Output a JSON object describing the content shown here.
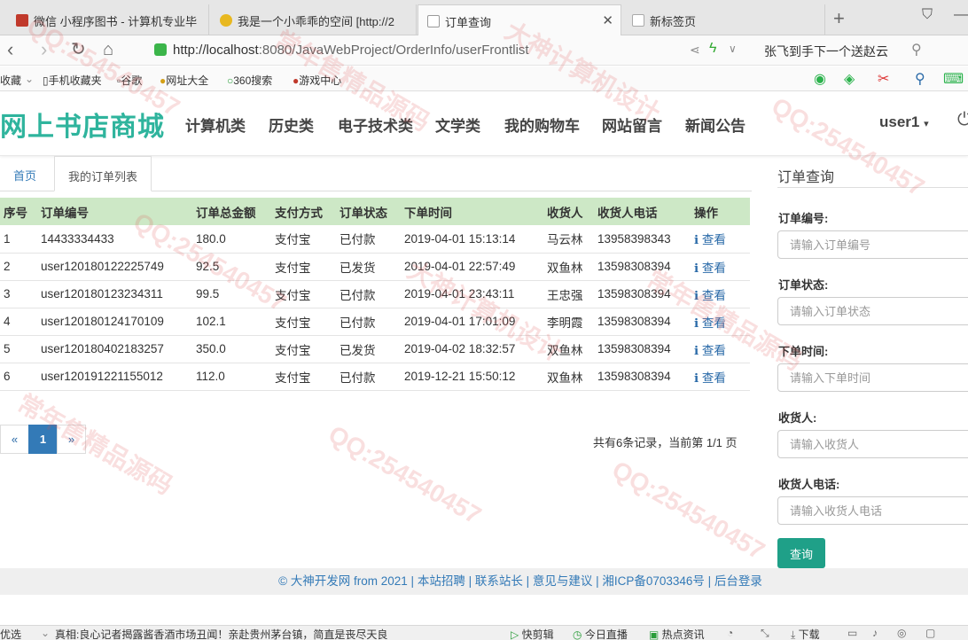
{
  "browser": {
    "tabs": [
      {
        "label": "微信 小程序图书 - 计算机专业毕",
        "fav": "#c0392b"
      },
      {
        "label": "我是一个小乖乖的空间 [http://2",
        "fav": "#e8b820"
      },
      {
        "label": "订单查询",
        "fav": "#999"
      },
      {
        "label": "新标签页",
        "fav": "#aaa"
      }
    ],
    "url_host": "http://localhost",
    "url_path": ":8080/JavaWebProject/OrderInfo/userFrontlist",
    "search_hint": "张飞到手下一个送赵云",
    "bookmarks": [
      "收藏",
      "手机收藏夹",
      "谷歌",
      "网址大全",
      "360搜索",
      "游戏中心"
    ]
  },
  "site": {
    "brand": "网上书店商城",
    "nav": [
      "计算机类",
      "历史类",
      "电子技术类",
      "文学类",
      "我的购物车",
      "网站留言",
      "新闻公告"
    ],
    "user": "user1"
  },
  "content_tabs": [
    "首页",
    "我的订单列表"
  ],
  "table": {
    "headers": [
      "序号",
      "订单编号",
      "订单总金额",
      "支付方式",
      "订单状态",
      "下单时间",
      "收货人",
      "收货人电话",
      "操作"
    ],
    "rows": [
      [
        "1",
        "14433334433",
        "180.0",
        "支付宝",
        "已付款",
        "2019-04-01 15:13:14",
        "马云林",
        "13958398343"
      ],
      [
        "2",
        "user120180122225749",
        "92.5",
        "支付宝",
        "已发货",
        "2019-04-01 22:57:49",
        "双鱼林",
        "13598308394"
      ],
      [
        "3",
        "user120180123234311",
        "99.5",
        "支付宝",
        "已付款",
        "2019-04-01 23:43:11",
        "王忠强",
        "13598308394"
      ],
      [
        "4",
        "user120180124170109",
        "102.1",
        "支付宝",
        "已付款",
        "2019-04-01 17:01:09",
        "李明霞",
        "13598308394"
      ],
      [
        "5",
        "user120180402183257",
        "350.0",
        "支付宝",
        "已发货",
        "2019-04-02 18:32:57",
        "双鱼林",
        "13598308394"
      ],
      [
        "6",
        "user120191221155012",
        "112.0",
        "支付宝",
        "已付款",
        "2019-12-21 15:50:12",
        "双鱼林",
        "13598308394"
      ]
    ],
    "action_label": "查看"
  },
  "pager": {
    "prev": "«",
    "current": "1",
    "next": "»",
    "info": "共有6条记录，当前第 1/1 页"
  },
  "sidebar": {
    "title": "订单查询",
    "fields": [
      {
        "label": "订单编号:",
        "placeholder": "请输入订单编号"
      },
      {
        "label": "订单状态:",
        "placeholder": "请输入订单状态"
      },
      {
        "label": "下单时间:",
        "placeholder": "请输入下单时间"
      },
      {
        "label": "收货人:",
        "placeholder": "请输入收货人"
      },
      {
        "label": "收货人电话:",
        "placeholder": "请输入收货人电话"
      }
    ],
    "button": "查询"
  },
  "footer": "© 大神开发网 from 2021 | 本站招聘 | 联系站长 | 意见与建议 | 湘ICP备0703346号 | 后台登录",
  "statusbar": {
    "left": "优选",
    "news": "真相:良心记者揭露酱香酒市场丑闻！亲赴贵州茅台镇，简直是丧尽天良",
    "items": [
      "快剪辑",
      "今日直播",
      "热点资讯",
      "下载"
    ]
  },
  "watermark": [
    "QQ:254540457",
    "常年售精品源码",
    "大神计算机设计"
  ]
}
